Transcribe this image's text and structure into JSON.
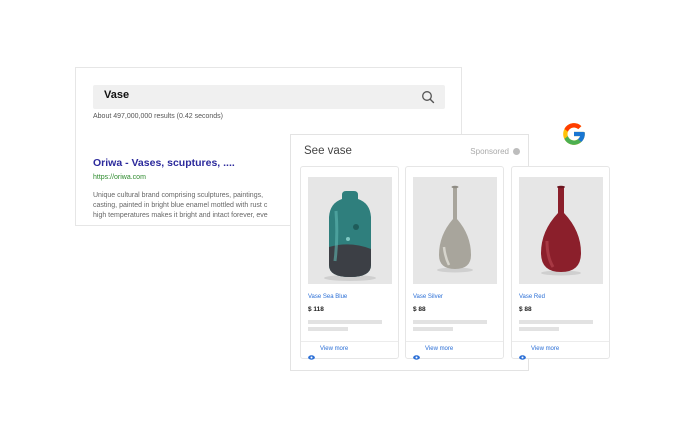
{
  "search": {
    "query": "Vase",
    "results_count": "About 497,000,000 results (0.42 seconds)"
  },
  "result": {
    "title": "Oriwa - Vases, scuptures, ....",
    "url": "https://oriwa.com",
    "snippet_lines": [
      "Unique cultural brand comprising sculptures, paintings,",
      "casting, painted in bright blue enamel mottled with rust c",
      "high temperatures makes it bright and intact forever, eve"
    ]
  },
  "shopping": {
    "title": "See vase",
    "sponsored_label": "Sponsored",
    "products": [
      {
        "name": "Vase Sea Blue",
        "price": "$ 118",
        "view_label": "View more",
        "color": "#3a8f8c"
      },
      {
        "name": "Vase Silver",
        "price": "$ 88",
        "view_label": "View more",
        "color": "#a8a59c"
      },
      {
        "name": "Vase Red",
        "price": "$ 88",
        "view_label": "View more",
        "color": "#8b1f2b"
      }
    ]
  },
  "icons": {
    "search": "search-icon",
    "info": "info-icon",
    "eye": "eye-icon",
    "logo": "google-logo"
  },
  "colors": {
    "link_blue": "#2b6fd6",
    "title_purple": "#2c2a9c",
    "url_green": "#2e8b2e"
  }
}
